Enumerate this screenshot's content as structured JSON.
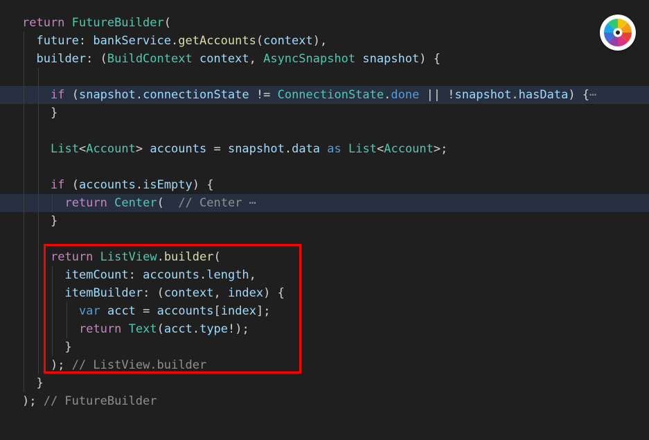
{
  "lines": [
    {
      "indent": 0,
      "hl": false,
      "tokens": [
        [
          "return ",
          "kw"
        ],
        [
          "FutureBuilder",
          "type"
        ],
        [
          "(",
          "p"
        ]
      ]
    },
    {
      "indent": 1,
      "hl": false,
      "tokens": [
        [
          "future",
          "var"
        ],
        [
          ": ",
          "p"
        ],
        [
          "bankService",
          "var"
        ],
        [
          ".",
          "p"
        ],
        [
          "getAccounts",
          "fn"
        ],
        [
          "(",
          "p"
        ],
        [
          "context",
          "var"
        ],
        [
          "),",
          "p"
        ]
      ]
    },
    {
      "indent": 1,
      "hl": false,
      "tokens": [
        [
          "builder",
          "var"
        ],
        [
          ": (",
          "p"
        ],
        [
          "BuildContext",
          "type"
        ],
        [
          " ",
          "p"
        ],
        [
          "context",
          "var"
        ],
        [
          ", ",
          "p"
        ],
        [
          "AsyncSnapshot",
          "type"
        ],
        [
          " ",
          "p"
        ],
        [
          "snapshot",
          "var"
        ],
        [
          ") {",
          "p"
        ]
      ]
    },
    {
      "indent": 0,
      "hl": false,
      "tokens": [],
      "guides": 2
    },
    {
      "indent": 2,
      "hl": true,
      "tokens": [
        [
          "if",
          "kw"
        ],
        [
          " (",
          "p"
        ],
        [
          "snapshot",
          "var"
        ],
        [
          ".",
          "p"
        ],
        [
          "connectionState",
          "var"
        ],
        [
          " != ",
          "p"
        ],
        [
          "ConnectionState",
          "type"
        ],
        [
          ".",
          "p"
        ],
        [
          "done",
          "blue"
        ],
        [
          " || !",
          "p"
        ],
        [
          "snapshot",
          "var"
        ],
        [
          ".",
          "p"
        ],
        [
          "hasData",
          "var"
        ],
        [
          ") {",
          "p"
        ],
        [
          "⋯",
          "fold"
        ]
      ]
    },
    {
      "indent": 2,
      "hl": false,
      "tokens": [
        [
          "}",
          "p"
        ]
      ]
    },
    {
      "indent": 0,
      "hl": false,
      "tokens": [],
      "guides": 2
    },
    {
      "indent": 2,
      "hl": false,
      "tokens": [
        [
          "List",
          "type"
        ],
        [
          "<",
          "p"
        ],
        [
          "Account",
          "type"
        ],
        [
          "> ",
          "p"
        ],
        [
          "accounts",
          "var"
        ],
        [
          " = ",
          "p"
        ],
        [
          "snapshot",
          "var"
        ],
        [
          ".",
          "p"
        ],
        [
          "data",
          "var"
        ],
        [
          " ",
          "p"
        ],
        [
          "as",
          "blue"
        ],
        [
          " ",
          "p"
        ],
        [
          "List",
          "type"
        ],
        [
          "<",
          "p"
        ],
        [
          "Account",
          "type"
        ],
        [
          ">;",
          "p"
        ]
      ]
    },
    {
      "indent": 0,
      "hl": false,
      "tokens": [],
      "guides": 2
    },
    {
      "indent": 2,
      "hl": false,
      "tokens": [
        [
          "if",
          "kw"
        ],
        [
          " (",
          "p"
        ],
        [
          "accounts",
          "var"
        ],
        [
          ".",
          "p"
        ],
        [
          "isEmpty",
          "var"
        ],
        [
          ") {",
          "p"
        ]
      ]
    },
    {
      "indent": 3,
      "hl": true,
      "tokens": [
        [
          "return",
          "kw"
        ],
        [
          " ",
          "p"
        ],
        [
          "Center",
          "type"
        ],
        [
          "(  ",
          "p"
        ],
        [
          "// Center ",
          "cm"
        ],
        [
          "⋯",
          "fold"
        ]
      ]
    },
    {
      "indent": 2,
      "hl": false,
      "tokens": [
        [
          "}",
          "p"
        ]
      ]
    },
    {
      "indent": 0,
      "hl": false,
      "tokens": [],
      "guides": 2
    },
    {
      "indent": 2,
      "hl": false,
      "tokens": [
        [
          "return",
          "kw"
        ],
        [
          " ",
          "p"
        ],
        [
          "ListView",
          "type"
        ],
        [
          ".",
          "p"
        ],
        [
          "builder",
          "fn"
        ],
        [
          "(",
          "p"
        ]
      ]
    },
    {
      "indent": 3,
      "hl": false,
      "tokens": [
        [
          "itemCount",
          "var"
        ],
        [
          ": ",
          "p"
        ],
        [
          "accounts",
          "var"
        ],
        [
          ".",
          "p"
        ],
        [
          "length",
          "var"
        ],
        [
          ",",
          "p"
        ]
      ]
    },
    {
      "indent": 3,
      "hl": false,
      "tokens": [
        [
          "itemBuilder",
          "var"
        ],
        [
          ": (",
          "p"
        ],
        [
          "context",
          "var"
        ],
        [
          ", ",
          "p"
        ],
        [
          "index",
          "var"
        ],
        [
          ") {",
          "p"
        ]
      ]
    },
    {
      "indent": 4,
      "hl": false,
      "tokens": [
        [
          "var",
          "blue"
        ],
        [
          " ",
          "p"
        ],
        [
          "acct",
          "var"
        ],
        [
          " = ",
          "p"
        ],
        [
          "accounts",
          "var"
        ],
        [
          "[",
          "p"
        ],
        [
          "index",
          "var"
        ],
        [
          "];",
          "p"
        ]
      ]
    },
    {
      "indent": 4,
      "hl": false,
      "tokens": [
        [
          "return",
          "kw"
        ],
        [
          " ",
          "p"
        ],
        [
          "Text",
          "type"
        ],
        [
          "(",
          "p"
        ],
        [
          "acct",
          "var"
        ],
        [
          ".",
          "p"
        ],
        [
          "type",
          "var"
        ],
        [
          "!);",
          "p"
        ]
      ]
    },
    {
      "indent": 3,
      "hl": false,
      "tokens": [
        [
          "}",
          "p"
        ]
      ]
    },
    {
      "indent": 2,
      "hl": false,
      "tokens": [
        [
          "); ",
          "p"
        ],
        [
          "// ListView.builder",
          "cm"
        ]
      ]
    },
    {
      "indent": 1,
      "hl": false,
      "tokens": [
        [
          "}",
          "p"
        ]
      ]
    },
    {
      "indent": 0,
      "hl": false,
      "tokens": [
        [
          "); ",
          "p"
        ],
        [
          "// FutureBuilder",
          "cm"
        ]
      ]
    }
  ],
  "colors": {
    "background": "#1f1f1f",
    "line_highlight": "#263040",
    "keyword": "#c586c0",
    "type": "#4ec9b0",
    "function": "#dcdcaa",
    "variable": "#9cdcfe",
    "annotation_box": "#ff0000"
  },
  "overlay_icon": "color-wheel-icon"
}
